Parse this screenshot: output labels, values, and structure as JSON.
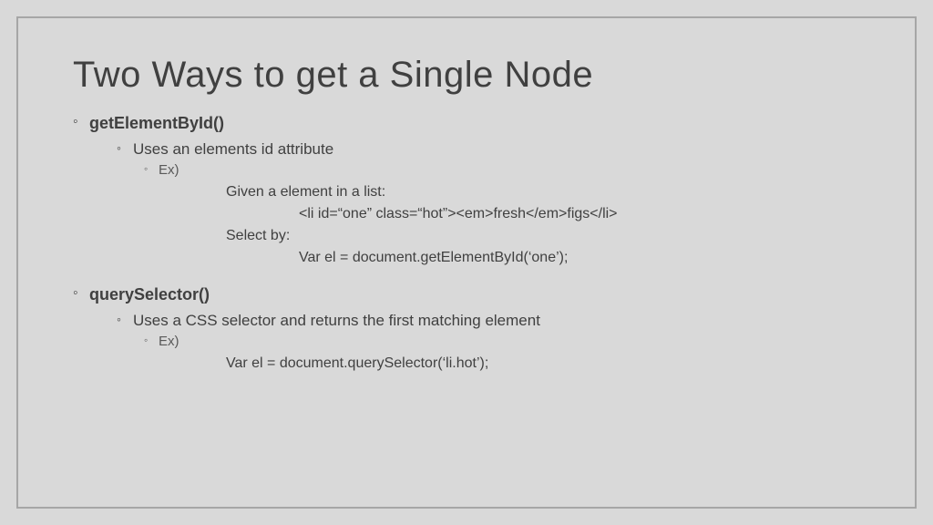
{
  "title": "Two Ways to get a Single Node",
  "methods": [
    {
      "name": "getElementById()",
      "desc": "Uses an elements id attribute",
      "exLabel": "Ex)",
      "lines": [
        {
          "indent": "i1",
          "text": "Given a element in a list:"
        },
        {
          "indent": "i2",
          "text": "<li id=“one” class=“hot”><em>fresh</em>figs</li>"
        },
        {
          "indent": "i1",
          "text": "Select by:"
        },
        {
          "indent": "i2",
          "text": "Var el = document.getElementById(‘one’);"
        }
      ]
    },
    {
      "name": "querySelector()",
      "desc": "Uses a CSS selector and returns the first matching element",
      "exLabel": "Ex)",
      "lines": [
        {
          "indent": "i1",
          "text": "Var el = document.querySelector(‘li.hot’);"
        }
      ]
    }
  ]
}
